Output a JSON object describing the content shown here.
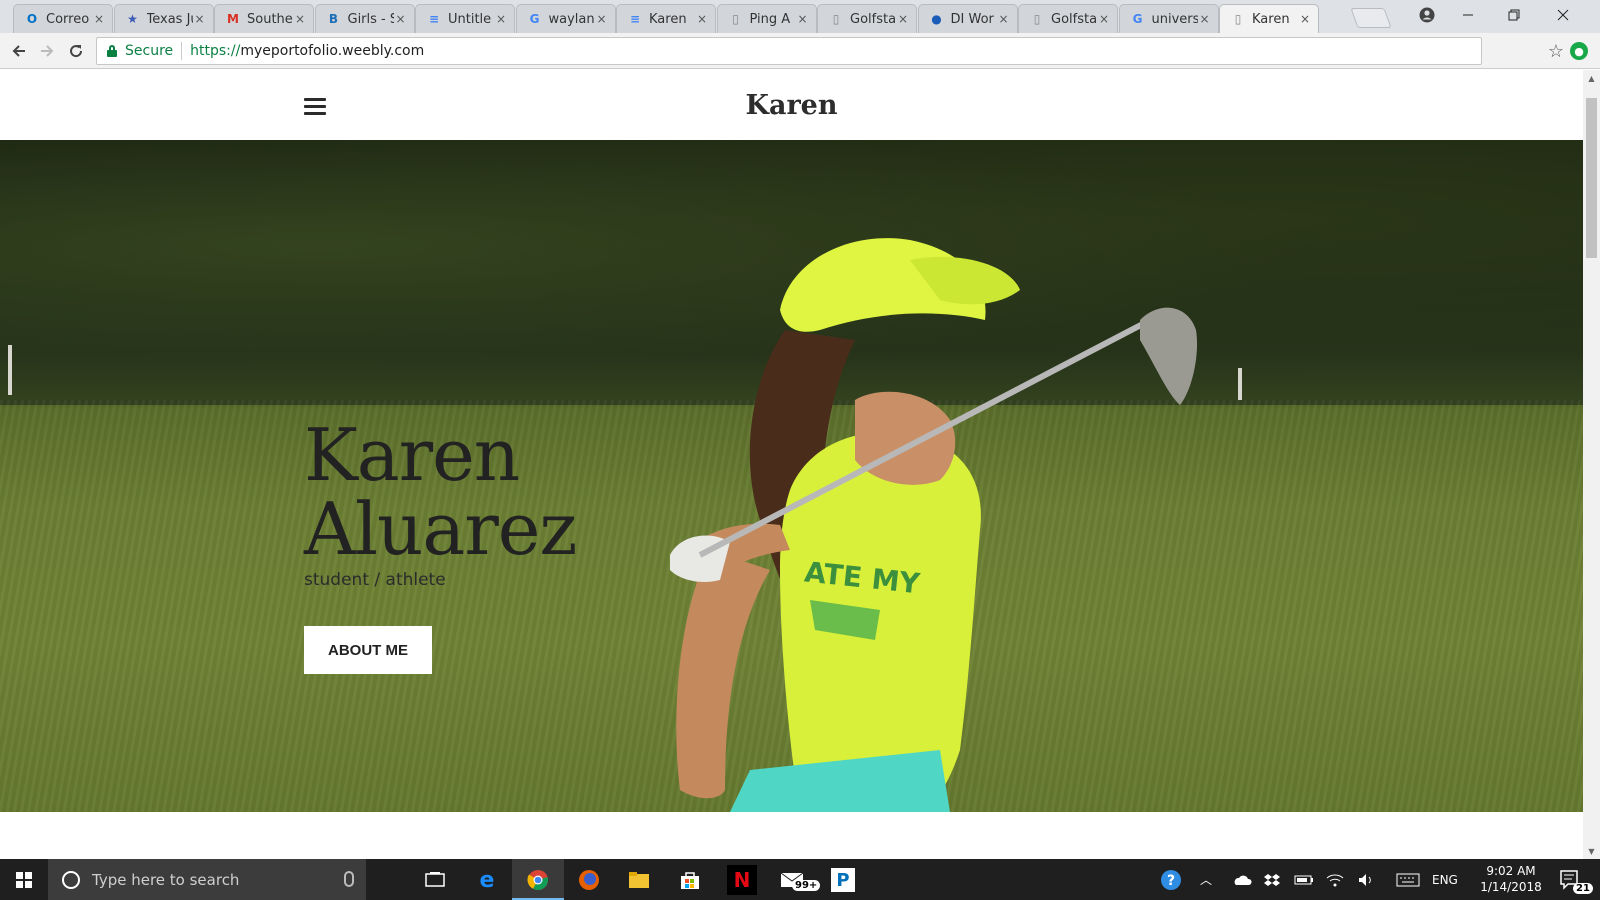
{
  "browser": {
    "tabs": [
      {
        "title": "Correo",
        "favicon": "outlook-icon",
        "color": "#0072c6",
        "glyph": "O"
      },
      {
        "title": "Texas Ju",
        "favicon": "texas-star-icon",
        "color": "#3b5bb5",
        "glyph": "★"
      },
      {
        "title": "Southe",
        "favicon": "gmail-icon",
        "color": "#d93025",
        "glyph": "M"
      },
      {
        "title": "Girls - S",
        "favicon": "b-logo-icon",
        "color": "#1e6fb5",
        "glyph": "B"
      },
      {
        "title": "Untitle",
        "favicon": "docs-icon",
        "color": "#4285f4",
        "glyph": "≡"
      },
      {
        "title": "waylan",
        "favicon": "google-icon",
        "color": "#4285f4",
        "glyph": "G"
      },
      {
        "title": "Karen",
        "favicon": "docs-icon",
        "color": "#4285f4",
        "glyph": "≡"
      },
      {
        "title": "Ping A",
        "favicon": "page-icon",
        "color": "#888888",
        "glyph": "▯"
      },
      {
        "title": "Golfsta",
        "favicon": "page-icon",
        "color": "#888888",
        "glyph": "▯"
      },
      {
        "title": "DI Wor",
        "favicon": "ncaa-icon",
        "color": "#1a5db8",
        "glyph": "●"
      },
      {
        "title": "Golfsta",
        "favicon": "page-icon",
        "color": "#888888",
        "glyph": "▯"
      },
      {
        "title": "univers",
        "favicon": "google-icon",
        "color": "#4285f4",
        "glyph": "G"
      },
      {
        "title": "Karen",
        "favicon": "page-icon",
        "color": "#888888",
        "glyph": "▯",
        "active": true
      }
    ],
    "close_glyph": "×",
    "omnibox": {
      "secure_label": "Secure",
      "url_scheme": "https://",
      "url_host": "myeportofolio.weebly.com"
    }
  },
  "page": {
    "site_title": "Karen",
    "hero": {
      "name_line1": "Karen",
      "name_line2": "Aluarez",
      "subtitle": "student / athlete",
      "button_label": "ABOUT ME"
    }
  },
  "taskbar": {
    "search_placeholder": "Type here to search",
    "mail_badge": "99+",
    "language": "ENG",
    "time": "9:02 AM",
    "date": "1/14/2018",
    "notification_count": "21"
  },
  "colors": {
    "secure_green": "#0b8043",
    "taskbar_bg": "#1f1f1f",
    "hero_text": "#222222"
  }
}
